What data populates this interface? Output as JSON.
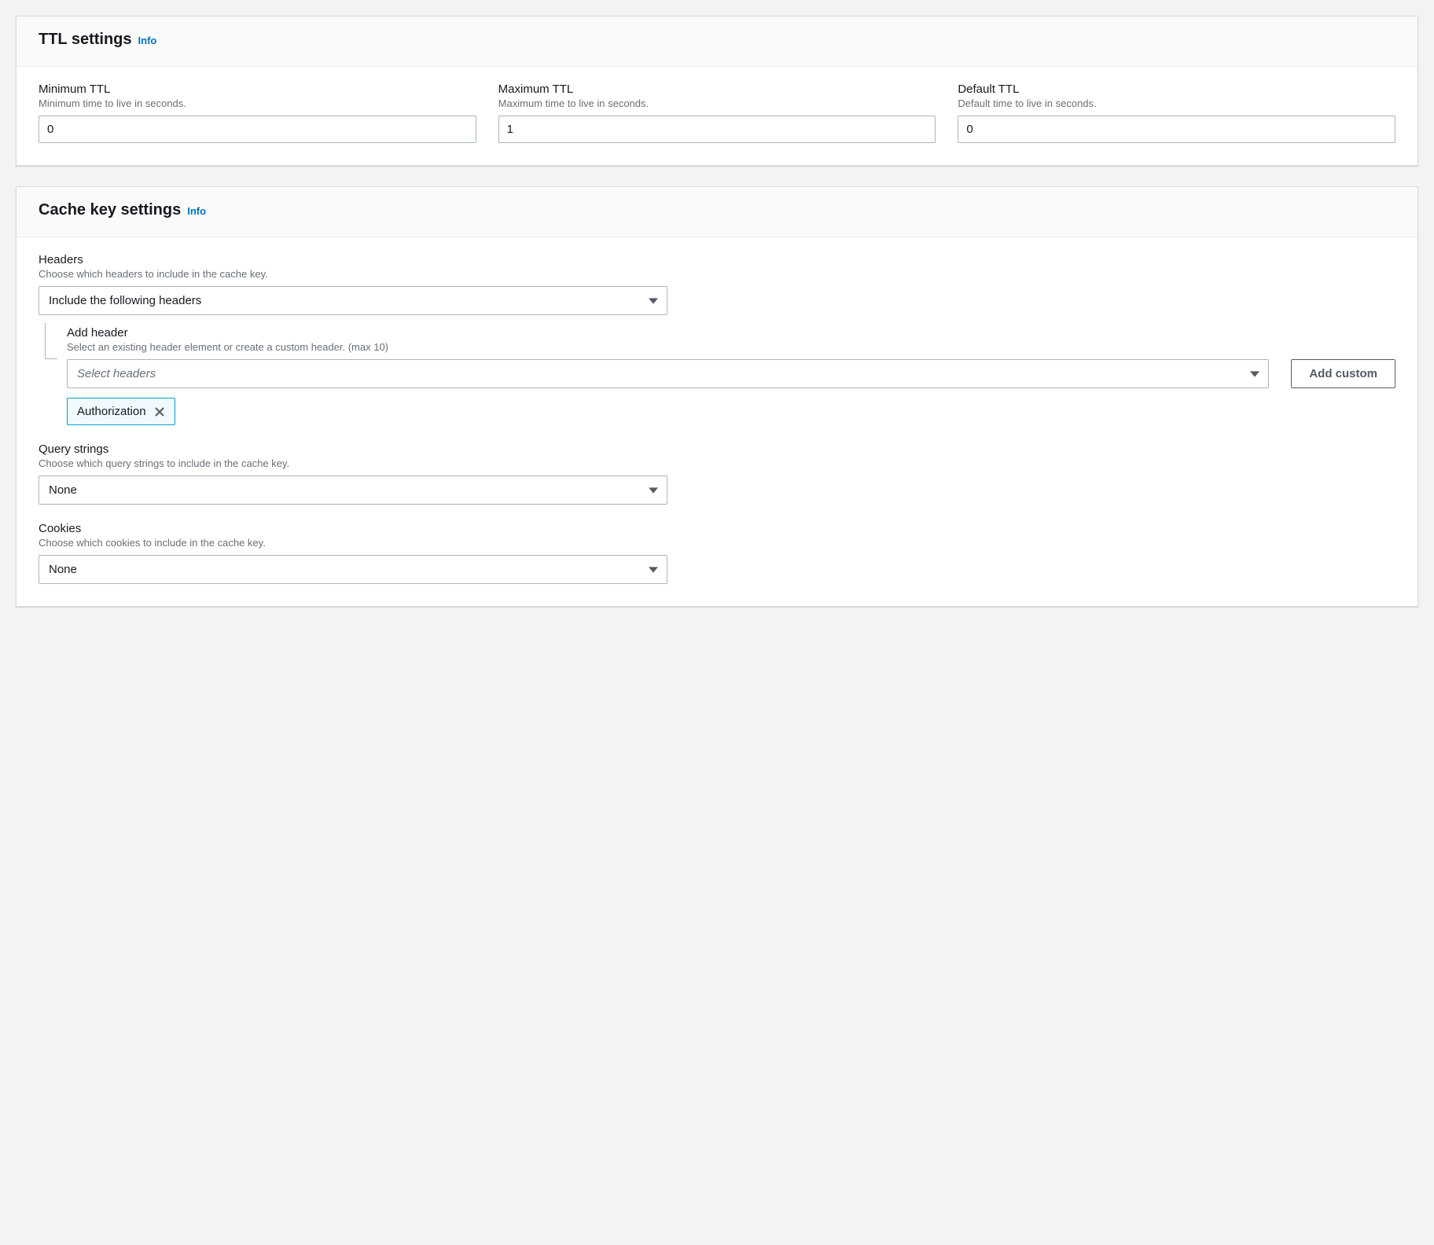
{
  "ttl": {
    "title": "TTL settings",
    "info": "Info",
    "min": {
      "label": "Minimum TTL",
      "desc": "Minimum time to live in seconds.",
      "value": "0"
    },
    "max": {
      "label": "Maximum TTL",
      "desc": "Maximum time to live in seconds.",
      "value": "1"
    },
    "default": {
      "label": "Default TTL",
      "desc": "Default time to live in seconds.",
      "value": "0"
    }
  },
  "cache": {
    "title": "Cache key settings",
    "info": "Info",
    "headers": {
      "label": "Headers",
      "desc": "Choose which headers to include in the cache key.",
      "selected": "Include the following headers",
      "add_label": "Add header",
      "add_desc": "Select an existing header element or create a custom header. (max 10)",
      "placeholder": "Select headers",
      "add_custom_btn": "Add custom",
      "token": "Authorization"
    },
    "query": {
      "label": "Query strings",
      "desc": "Choose which query strings to include in the cache key.",
      "selected": "None"
    },
    "cookies": {
      "label": "Cookies",
      "desc": "Choose which cookies to include in the cache key.",
      "selected": "None"
    }
  }
}
